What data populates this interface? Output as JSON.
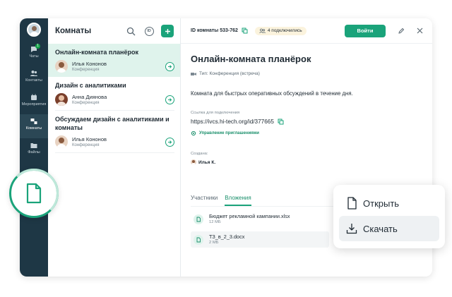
{
  "rail": {
    "items": [
      {
        "label": "Чаты",
        "badge": "1"
      },
      {
        "label": "Контакты"
      },
      {
        "label": "Мероприятия"
      },
      {
        "label": "Комнаты"
      },
      {
        "label": "Файлы"
      }
    ]
  },
  "list": {
    "title": "Комнаты",
    "id_button": "ID",
    "rooms": [
      {
        "title": "Онлайн-комната планёрок",
        "owner": "Илья Кононов",
        "type": "Конференция"
      },
      {
        "title": "Дизайн с аналитиками",
        "owner": "Анна Диянова",
        "type": "Конференция"
      },
      {
        "title": "Обсуждаем дизайн с аналитиками и комнаты",
        "owner": "Илья Кононов",
        "type": "Конференция"
      }
    ]
  },
  "detail": {
    "room_id": "ID комнаты 533-762",
    "joined": "4 подключились",
    "enter_label": "Войти",
    "title": "Онлайн-комната планёрок",
    "type": "Тип: Конференция (встреча)",
    "description": "Комната для быстрых оперативных обсуждений в течение дня.",
    "link_label": "Ссылка для подключения",
    "link": "https://ivcs.hi-tech.org/id/377665",
    "manage_label": "Управление приглашениями",
    "created_label": "Создана:",
    "creator": "Илья К.",
    "tabs": [
      "Участники",
      "Вложения"
    ],
    "files": [
      {
        "name": "Бюджет рекламной кампании.xlsx",
        "size": "12 МБ"
      },
      {
        "name": "ТЗ_в_2_3.docx",
        "size": "2 МБ"
      }
    ]
  },
  "context_menu": {
    "open": "Открыть",
    "download": "Скачать"
  },
  "colors": {
    "accent": "#1aa37a",
    "rail": "#1e3745",
    "selected_row": "#dff3ec",
    "joined_chip": "#fbf3dd"
  }
}
